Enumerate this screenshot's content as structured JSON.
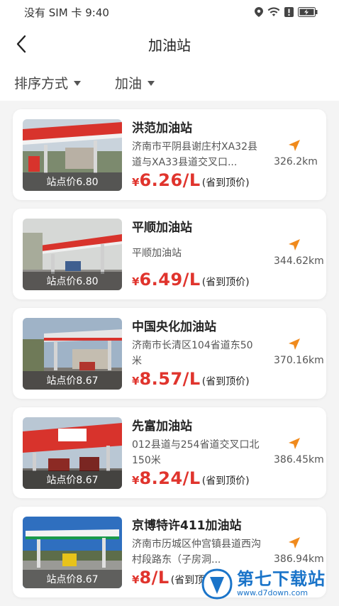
{
  "status_bar": {
    "carrier": "没有 SIM 卡",
    "time": "9:40"
  },
  "header": {
    "title": "加油站"
  },
  "filters": [
    {
      "label": "排序方式"
    },
    {
      "label": "加油"
    }
  ],
  "stations": [
    {
      "name": "洪范加油站",
      "address": "济南市平阴县谢庄村XA32县道与XA33县道交叉口...",
      "station_price": "站点价6.80",
      "currency": "¥",
      "price": "6.26/L",
      "note": "(省到顶价)",
      "distance": "326.2km"
    },
    {
      "name": "平顺加油站",
      "address": "平顺加油站",
      "station_price": "站点价6.80",
      "currency": "¥",
      "price": "6.49/L",
      "note": "(省到顶价)",
      "distance": "344.62km"
    },
    {
      "name": "中国央化加油站",
      "address": "济南市长清区104省道东50米",
      "station_price": "站点价8.67",
      "currency": "¥",
      "price": "8.57/L",
      "note": "(省到顶价)",
      "distance": "370.16km"
    },
    {
      "name": "先富加油站",
      "address": "012县道与254省道交叉口北150米",
      "station_price": "站点价8.67",
      "currency": "¥",
      "price": "8.24/L",
      "note": "(省到顶价)",
      "distance": "386.45km"
    },
    {
      "name": "京博特许411加油站",
      "address": "济南市历城区仲宫镇县道西沟村段路东（子房洞...",
      "station_price": "站点价8.67",
      "currency": "¥",
      "price": "8/L",
      "note": "(省到顶价)",
      "distance": "386.94km"
    }
  ],
  "watermark": {
    "title": "第七下载站",
    "url": "www.d7down.com"
  },
  "colors": {
    "price": "#e0342d",
    "accent": "#f08a1c",
    "watermark": "#1a74c9"
  }
}
